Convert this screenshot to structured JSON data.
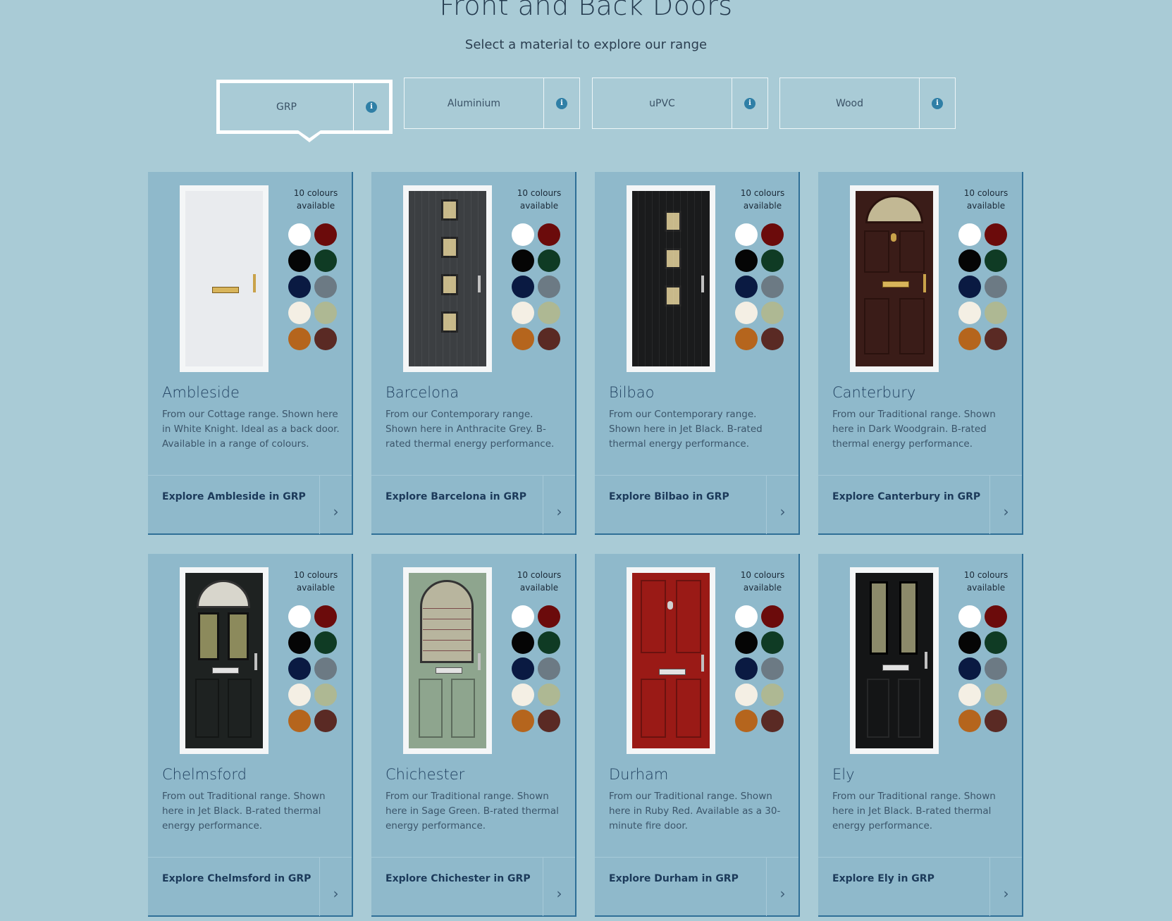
{
  "header": {
    "title": "Front and Back Doors",
    "subtitle": "Select a material to explore our range"
  },
  "tabs": [
    {
      "label": "GRP",
      "active": true
    },
    {
      "label": "Aluminium",
      "active": false
    },
    {
      "label": "uPVC",
      "active": false
    },
    {
      "label": "Wood",
      "active": false
    }
  ],
  "swatch_colors": [
    "#ffffff",
    "#6b0b0b",
    "#050505",
    "#0f3b24",
    "#0a1a42",
    "#6c7a84",
    "#f4efe4",
    "#aeb893",
    "#b5651d",
    "#5a2a24"
  ],
  "products": [
    {
      "name": "Ambleside",
      "colours": "10 colours available",
      "description": "From our Cottage range. Shown here in White Knight. Ideal as a back door. Available in a range of colours.",
      "link": "Explore Ambleside in GRP",
      "door_color": "#e9ebee",
      "door_style": "cottage-white"
    },
    {
      "name": "Barcelona",
      "colours": "10 colours available",
      "description": "From our Contemporary range. Shown here in Anthracite Grey. B-rated thermal energy performance.",
      "link": "Explore Barcelona in GRP",
      "door_color": "#3c3f42",
      "door_style": "contemporary"
    },
    {
      "name": "Bilbao",
      "colours": "10 colours available",
      "description": "From our Contemporary range. Shown here in Jet Black. B-rated thermal energy performance.",
      "link": "Explore Bilbao in GRP",
      "door_color": "#1a1b1c",
      "door_style": "contemporary-3"
    },
    {
      "name": "Canterbury",
      "colours": "10 colours available",
      "description": "From our Traditional range. Shown here in Dark Woodgrain. B-rated thermal energy performance.",
      "link": "Explore Canterbury in GRP",
      "door_color": "#3a1c18",
      "door_style": "fanlight"
    },
    {
      "name": "Chelmsford",
      "colours": "10 colours available",
      "description": "From out Traditional range. Shown here in Jet Black. B-rated thermal energy performance.",
      "link": "Explore Chelmsford in GRP",
      "door_color": "#1e2221",
      "door_style": "arched-2pane"
    },
    {
      "name": "Chichester",
      "colours": "10 colours available",
      "description": "From our Traditional range. Shown here in Sage Green. B-rated thermal energy performance.",
      "link": "Explore Chichester in GRP",
      "door_color": "#8ea58e",
      "door_style": "arched-lead"
    },
    {
      "name": "Durham",
      "colours": "10 colours available",
      "description": "From our Traditional range. Shown here in Ruby Red. Available as a 30-minute fire door.",
      "link": "Explore Durham in GRP",
      "door_color": "#9a1a16",
      "door_style": "panelled"
    },
    {
      "name": "Ely",
      "colours": "10 colours available",
      "description": "From our Traditional range. Shown here in Jet Black. B-rated thermal energy performance.",
      "link": "Explore Ely in GRP",
      "door_color": "#141516",
      "door_style": "2pane"
    }
  ]
}
